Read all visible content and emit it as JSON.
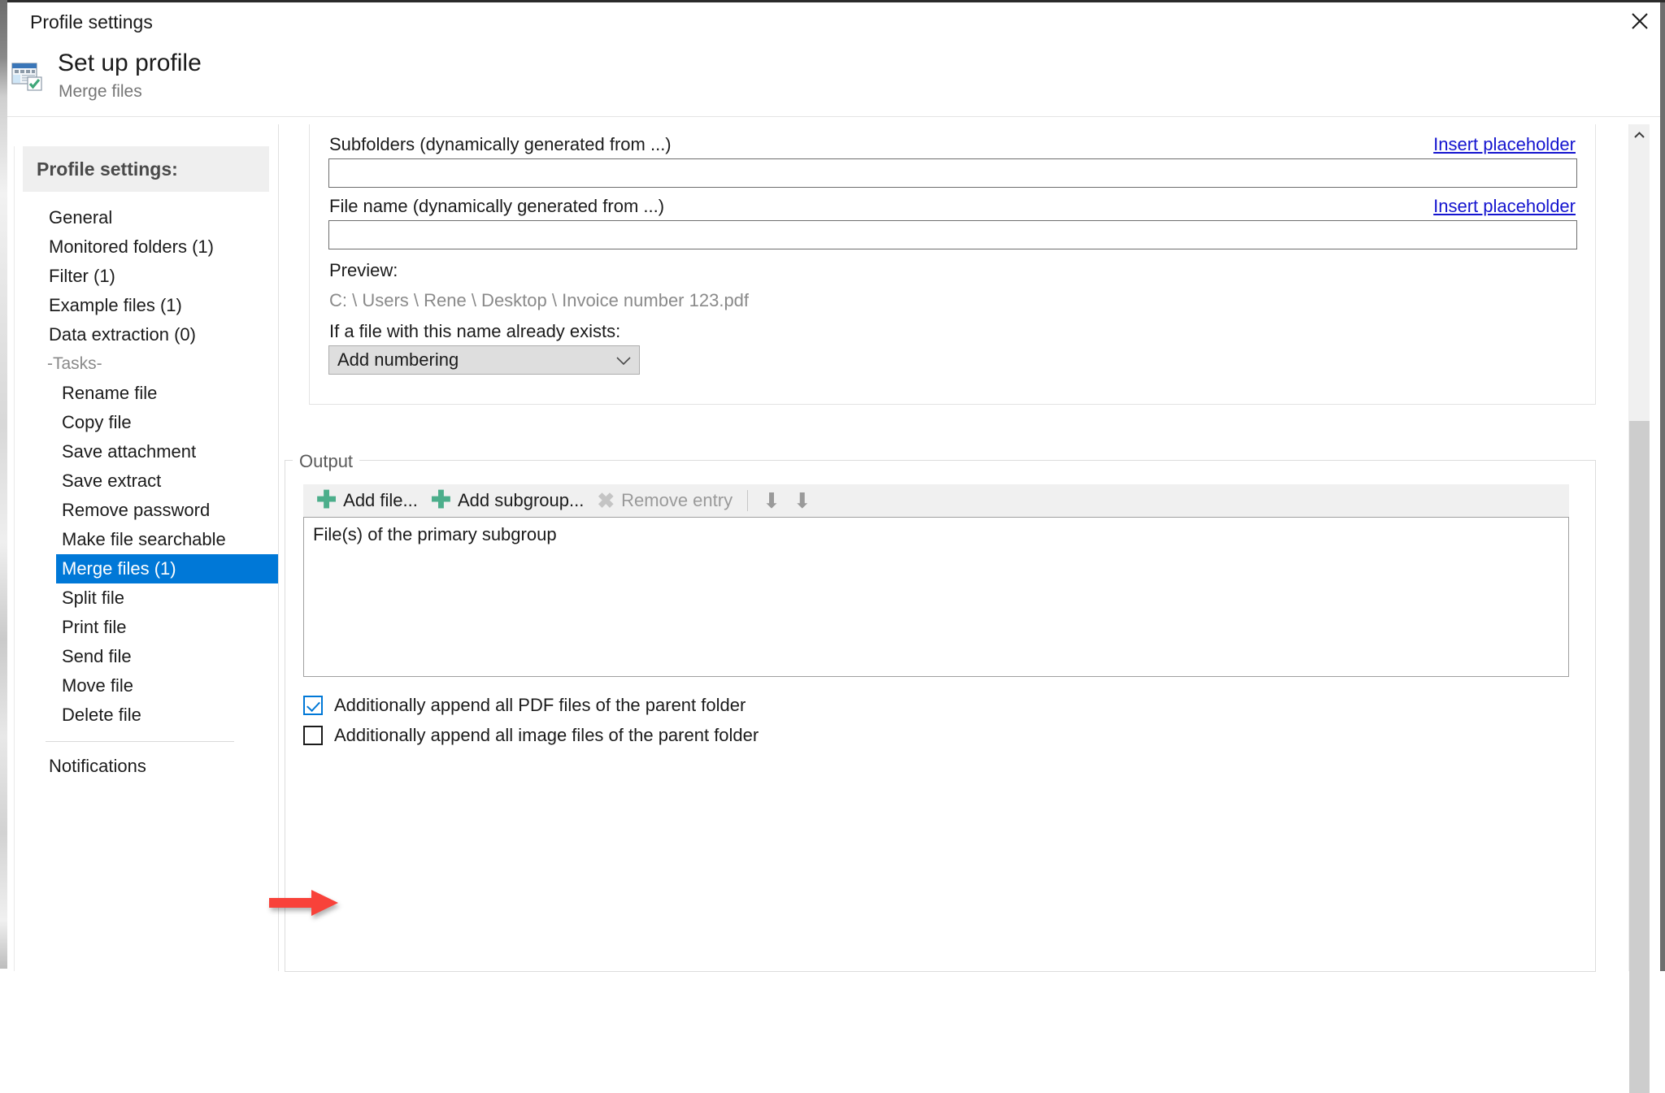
{
  "window": {
    "title": "Profile settings",
    "close_label": "Close",
    "close_icon": "close-icon"
  },
  "header": {
    "title": "Set up profile",
    "subtitle": "Merge files",
    "icon": "profile-window-check-icon"
  },
  "sidebar": {
    "heading": "Profile settings:",
    "items": [
      {
        "label": "General",
        "indent": false,
        "selected": false,
        "type": "item"
      },
      {
        "label": "Monitored folders (1)",
        "indent": false,
        "selected": false,
        "type": "item"
      },
      {
        "label": "Filter (1)",
        "indent": false,
        "selected": false,
        "type": "item"
      },
      {
        "label": "Example files (1)",
        "indent": false,
        "selected": false,
        "type": "item"
      },
      {
        "label": "Data extraction (0)",
        "indent": false,
        "selected": false,
        "type": "item"
      },
      {
        "label": "-Tasks-",
        "indent": false,
        "selected": false,
        "type": "group"
      },
      {
        "label": "Rename file",
        "indent": true,
        "selected": false,
        "type": "item"
      },
      {
        "label": "Copy file",
        "indent": true,
        "selected": false,
        "type": "item"
      },
      {
        "label": "Save attachment",
        "indent": true,
        "selected": false,
        "type": "item"
      },
      {
        "label": "Save extract",
        "indent": true,
        "selected": false,
        "type": "item"
      },
      {
        "label": "Remove password",
        "indent": true,
        "selected": false,
        "type": "item"
      },
      {
        "label": "Make file searchable",
        "indent": true,
        "selected": false,
        "type": "item"
      },
      {
        "label": "Merge files (1)",
        "indent": true,
        "selected": true,
        "type": "item"
      },
      {
        "label": "Split file",
        "indent": true,
        "selected": false,
        "type": "item"
      },
      {
        "label": "Print file",
        "indent": true,
        "selected": false,
        "type": "item"
      },
      {
        "label": "Send file",
        "indent": true,
        "selected": false,
        "type": "item"
      },
      {
        "label": "Move file",
        "indent": true,
        "selected": false,
        "type": "item"
      },
      {
        "label": "Delete file",
        "indent": true,
        "selected": false,
        "type": "item"
      },
      {
        "label": "Notifications",
        "indent": false,
        "selected": false,
        "type": "item"
      }
    ]
  },
  "main": {
    "subfolders": {
      "label": "Subfolders (dynamically generated from ...)",
      "value": "",
      "placeholder": "",
      "link": "Insert placeholder"
    },
    "filename": {
      "label": "File name (dynamically generated from ...)",
      "value": "",
      "placeholder": "",
      "link": "Insert placeholder"
    },
    "preview": {
      "label": "Preview:",
      "value": "C: \\ Users \\ Rene \\ Desktop \\ Invoice number 123.pdf"
    },
    "exists": {
      "label": "If a file with this name already exists:",
      "selected": "Add numbering"
    },
    "output": {
      "legend": "Output",
      "toolbar": {
        "add_file": "Add file...",
        "add_subgroup": "Add subgroup...",
        "remove_entry": "Remove entry",
        "move_up_icon": "arrow-up-icon",
        "move_down_icon": "arrow-down-icon"
      },
      "list_items": [
        "File(s) of the primary subgroup"
      ],
      "checkboxes": [
        {
          "label": "Additionally append all PDF files of the parent folder",
          "checked": true
        },
        {
          "label": "Additionally append all image files of the parent folder",
          "checked": false
        }
      ]
    }
  },
  "annotation": {
    "arrow_color": "#f8423a",
    "points_to": "Additionally append all PDF files of the parent folder"
  },
  "colors": {
    "accent": "#0078d7",
    "link": "#1414cf",
    "plus": "#4cae8b",
    "arrow": "#f8423a"
  }
}
